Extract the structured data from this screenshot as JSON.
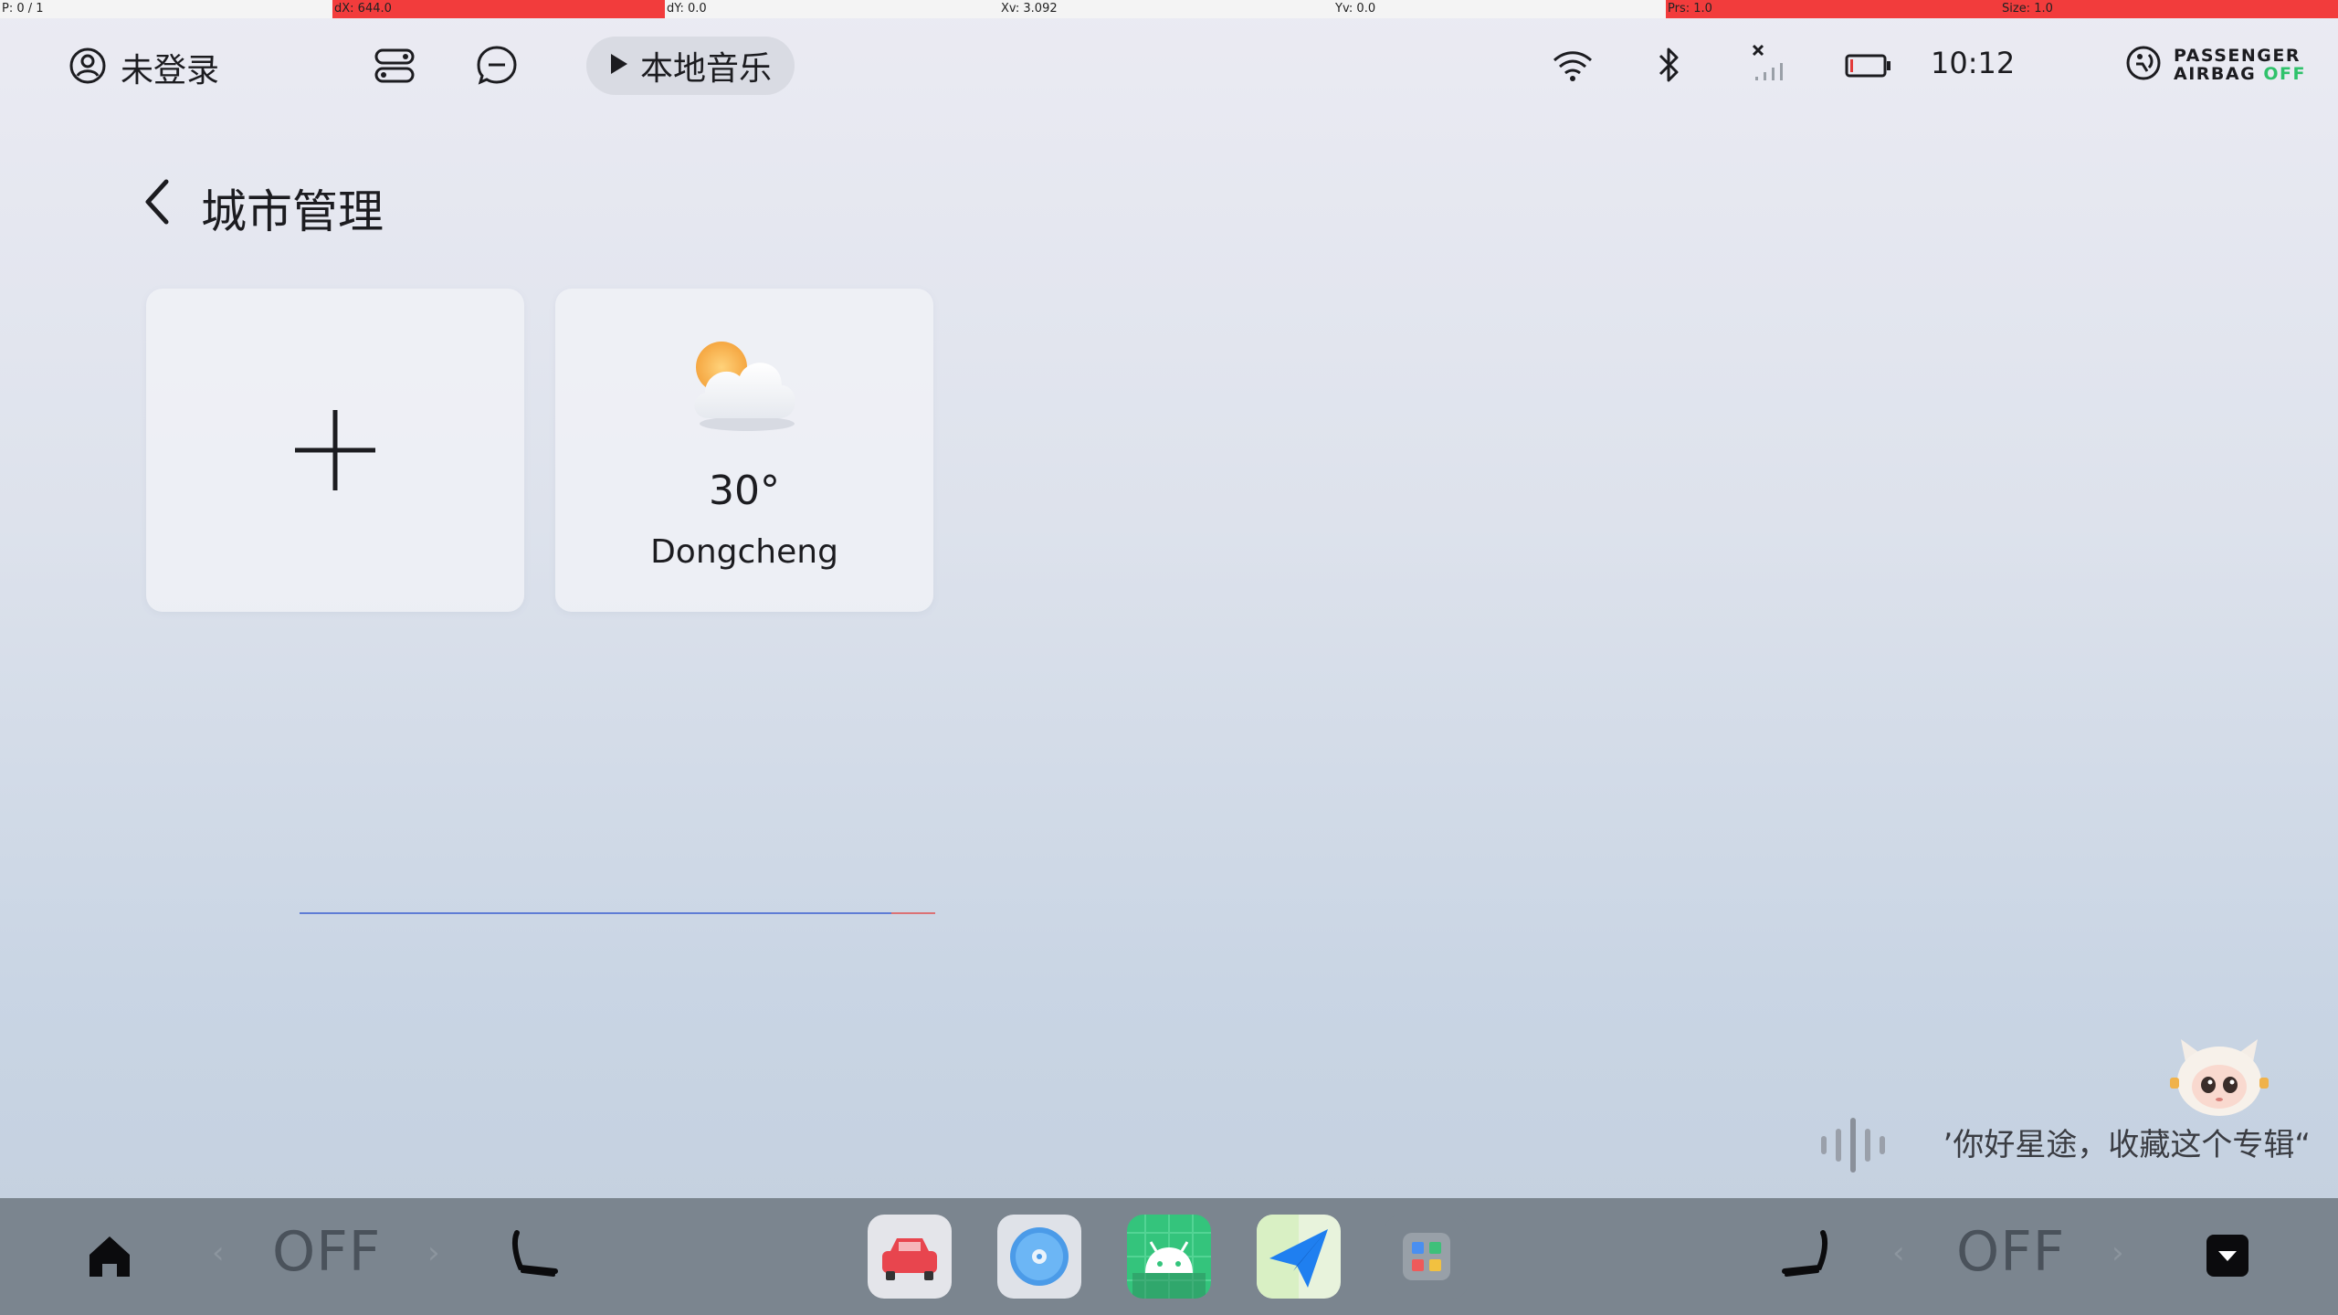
{
  "debug": {
    "pointer": "P: 0 / 1",
    "dx": "dX: 644.0",
    "dy": "dY: 0.0",
    "xv": "Xv: 3.092",
    "yv": "Yv: 0.0",
    "prs": "Prs: 1.0",
    "size": "Size: 1.0"
  },
  "status_bar": {
    "user_label": "未登录",
    "music_label": "本地音乐",
    "clock": "10:12",
    "airbag_line1": "PASSENGER",
    "airbag_line2_prefix": "AIRBAG ",
    "airbag_line2_state": "OFF",
    "icons": [
      "user-circle-icon",
      "toggle-switches-icon",
      "chat-bubble-icon",
      "play-icon",
      "wifi-icon",
      "bluetooth-icon",
      "no-signal-icon",
      "battery-icon",
      "airbag-icon"
    ]
  },
  "page": {
    "title": "城市管理"
  },
  "cities": [
    {
      "temperature": "30°",
      "name": "Dongcheng",
      "condition_icon": "partly-cloudy-icon"
    }
  ],
  "voice": {
    "hint": "“你好星途，收藏这个专辑”"
  },
  "dock": {
    "left_seat_label": "OFF",
    "right_seat_label": "OFF",
    "apps": [
      "car-app-icon",
      "music-disc-app-icon",
      "android-app-icon",
      "navigation-app-icon",
      "app-grid-icon"
    ]
  },
  "colors": {
    "accent_airbag_off": "#2fc26b",
    "debug_highlight": "#f23c3c",
    "dock_background": "#7b858f"
  }
}
